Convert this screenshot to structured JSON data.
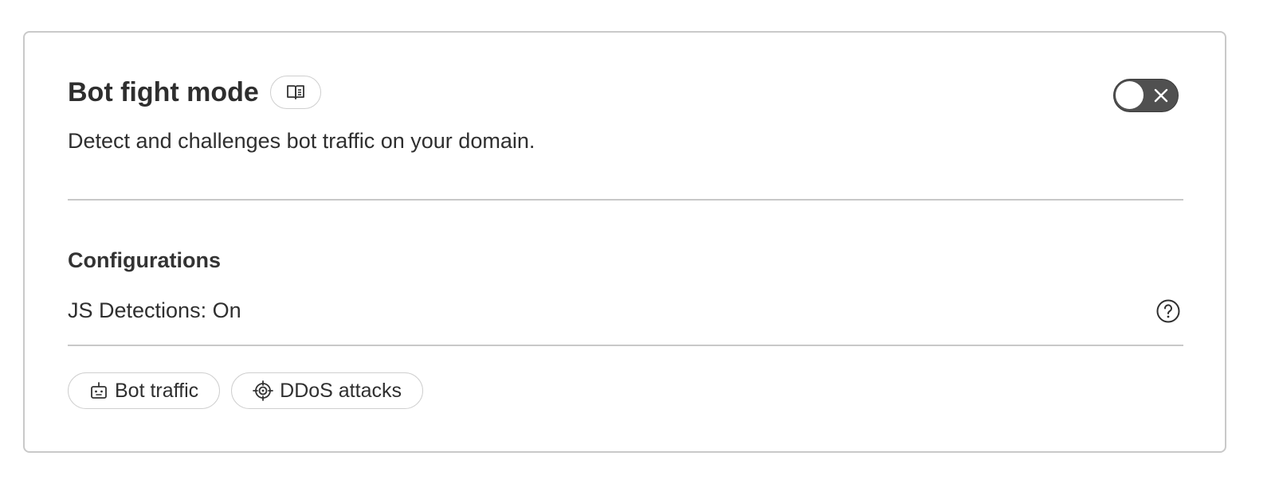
{
  "card": {
    "title": "Bot fight mode",
    "docs_icon": "book-open-icon",
    "description": "Detect and challenges bot traffic on your domain.",
    "toggle": {
      "state": "off",
      "icon": "close-icon"
    }
  },
  "configurations": {
    "heading": "Configurations",
    "js_detections": "JS Detections: On",
    "help_icon": "question-circle-icon"
  },
  "tags": [
    {
      "label": "Bot traffic",
      "icon": "robot-icon"
    },
    {
      "label": "DDoS attacks",
      "icon": "target-icon"
    }
  ]
}
